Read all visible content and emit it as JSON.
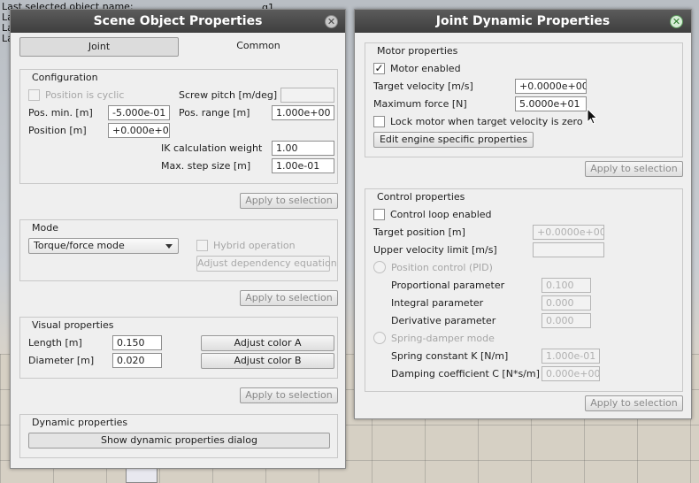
{
  "background": {
    "line1": "Last selected object name:",
    "line1_value": "g1",
    "line2": "La",
    "line3": "La",
    "line4": "La"
  },
  "left_dialog": {
    "title": "Scene Object Properties",
    "tabs": [
      {
        "label": "Joint",
        "active": true
      },
      {
        "label": "Common",
        "active": false
      }
    ],
    "configuration": {
      "title": "Configuration",
      "position_is_cyclic": "Position is cyclic",
      "screw_pitch_label": "Screw pitch [m/deg]",
      "screw_pitch_value": "",
      "pos_min_label": "Pos. min. [m]",
      "pos_min_value": "-5.000e-01",
      "pos_range_label": "Pos. range [m]",
      "pos_range_value": "1.000e+00",
      "position_label": "Position [m]",
      "position_value": "+0.000e+00",
      "ik_weight_label": "IK calculation weight",
      "ik_weight_value": "1.00",
      "max_step_label": "Max. step size [m]",
      "max_step_value": "1.00e-01",
      "apply_label": "Apply to selection"
    },
    "mode": {
      "title": "Mode",
      "selected": "Torque/force mode",
      "hybrid_label": "Hybrid operation",
      "adjust_dependency_label": "Adjust dependency equation",
      "apply_label": "Apply to selection"
    },
    "visual": {
      "title": "Visual properties",
      "length_label": "Length [m]",
      "length_value": "0.150",
      "diameter_label": "Diameter [m]",
      "diameter_value": "0.020",
      "color_a_label": "Adjust color A",
      "color_b_label": "Adjust color B",
      "apply_label": "Apply to selection"
    },
    "dynamic": {
      "title": "Dynamic properties",
      "show_dialog_label": "Show dynamic properties dialog"
    }
  },
  "right_dialog": {
    "title": "Joint Dynamic Properties",
    "motor": {
      "title": "Motor properties",
      "enabled_label": "Motor enabled",
      "enabled_checked": true,
      "target_velocity_label": "Target velocity [m/s]",
      "target_velocity_value": "+0.0000e+00",
      "max_force_label": "Maximum force [N]",
      "max_force_value": "5.0000e+01",
      "lock_label": "Lock motor when target velocity is zero",
      "edit_engine_label": "Edit engine specific properties",
      "apply_label": "Apply to selection"
    },
    "control": {
      "title": "Control properties",
      "loop_label": "Control loop enabled",
      "target_position_label": "Target position [m]",
      "target_position_value": "+0.0000e+00",
      "upper_velocity_label": "Upper velocity limit [m/s]",
      "upper_velocity_value": "",
      "pid_label": "Position control (PID)",
      "proportional_label": "Proportional parameter",
      "proportional_value": "0.100",
      "integral_label": "Integral parameter",
      "integral_value": "0.000",
      "derivative_label": "Derivative parameter",
      "derivative_value": "0.000",
      "spring_label": "Spring-damper mode",
      "spring_k_label": "Spring constant K [N/m]",
      "spring_k_value": "1.000e-01",
      "damping_label": "Damping coefficient C [N*s/m]",
      "damping_value": "0.000e+00",
      "apply_label": "Apply to selection"
    }
  },
  "icons": {
    "close": "close-icon",
    "checkmark": "check-icon",
    "dropdown": "chevron-down-icon",
    "cursor": "mouse-cursor-icon"
  }
}
